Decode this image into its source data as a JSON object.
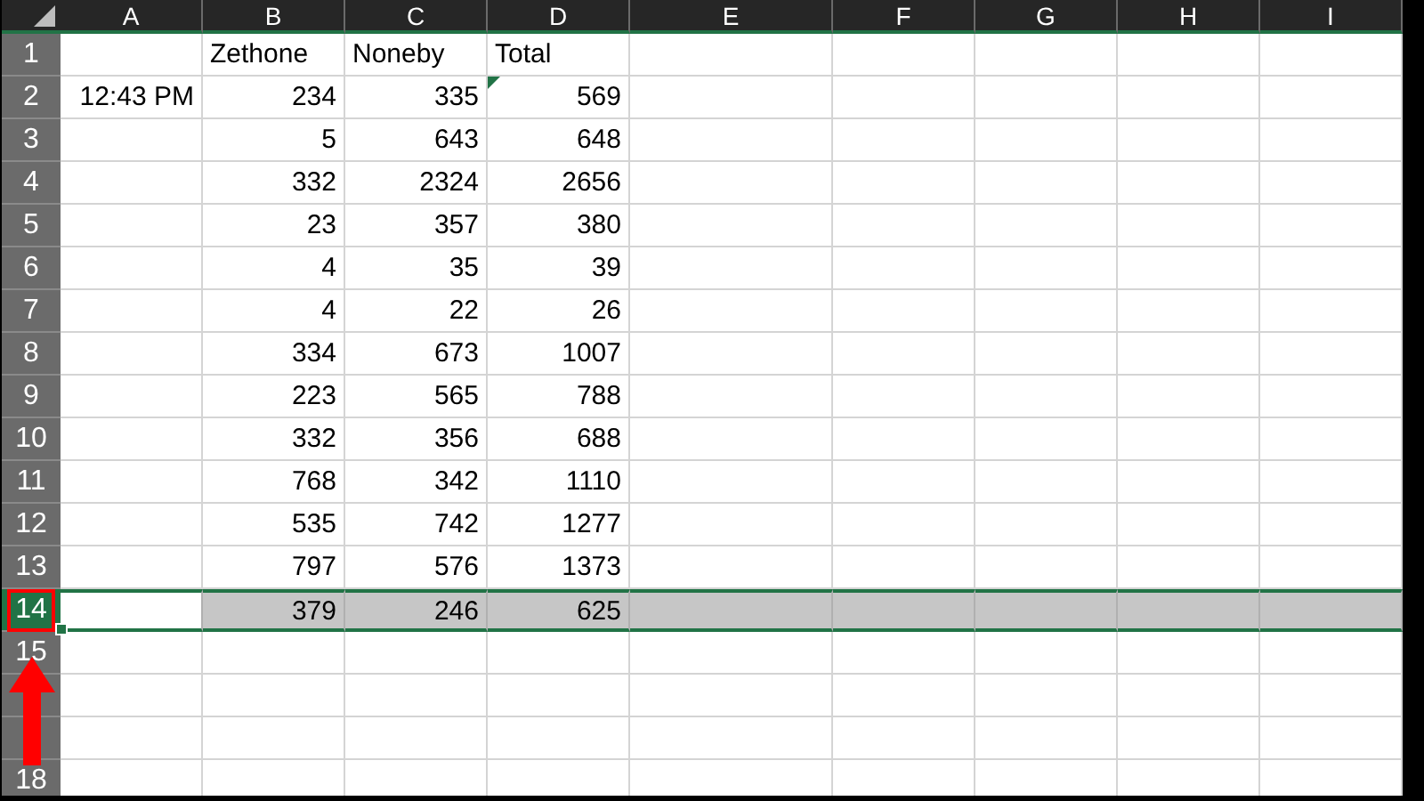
{
  "columns": [
    "A",
    "B",
    "C",
    "D",
    "E",
    "F",
    "G",
    "H",
    "I"
  ],
  "rows": [
    {
      "header": "1",
      "kind": "labels",
      "selected": false,
      "error_marker": false,
      "col_b": "Zethone",
      "col_c": "Noneby",
      "col_d": "Total"
    },
    {
      "header": "2",
      "kind": "values",
      "selected": false,
      "error_marker": true,
      "col_a": "12:43 PM",
      "col_b": "234",
      "col_c": "335",
      "col_d": "569"
    },
    {
      "header": "3",
      "kind": "values",
      "selected": false,
      "error_marker": false,
      "col_b": "5",
      "col_c": "643",
      "col_d": "648"
    },
    {
      "header": "4",
      "kind": "values",
      "selected": false,
      "error_marker": false,
      "col_b": "332",
      "col_c": "2324",
      "col_d": "2656"
    },
    {
      "header": "5",
      "kind": "values",
      "selected": false,
      "error_marker": false,
      "col_b": "23",
      "col_c": "357",
      "col_d": "380"
    },
    {
      "header": "6",
      "kind": "values",
      "selected": false,
      "error_marker": false,
      "col_b": "4",
      "col_c": "35",
      "col_d": "39"
    },
    {
      "header": "7",
      "kind": "values",
      "selected": false,
      "error_marker": false,
      "col_b": "4",
      "col_c": "22",
      "col_d": "26"
    },
    {
      "header": "8",
      "kind": "values",
      "selected": false,
      "error_marker": false,
      "col_b": "334",
      "col_c": "673",
      "col_d": "1007"
    },
    {
      "header": "9",
      "kind": "values",
      "selected": false,
      "error_marker": false,
      "col_b": "223",
      "col_c": "565",
      "col_d": "788"
    },
    {
      "header": "10",
      "kind": "values",
      "selected": false,
      "error_marker": false,
      "col_b": "332",
      "col_c": "356",
      "col_d": "688"
    },
    {
      "header": "11",
      "kind": "values",
      "selected": false,
      "error_marker": false,
      "col_b": "768",
      "col_c": "342",
      "col_d": "1110"
    },
    {
      "header": "12",
      "kind": "values",
      "selected": false,
      "error_marker": false,
      "col_b": "535",
      "col_c": "742",
      "col_d": "1277"
    },
    {
      "header": "13",
      "kind": "values",
      "selected": false,
      "error_marker": false,
      "col_b": "797",
      "col_c": "576",
      "col_d": "1373"
    },
    {
      "header": "14",
      "kind": "values",
      "selected": true,
      "error_marker": false,
      "col_b": "379",
      "col_c": "246",
      "col_d": "625"
    },
    {
      "header": "15",
      "kind": "values",
      "selected": false,
      "error_marker": false
    },
    {
      "kind": "values",
      "selected": false,
      "error_marker": false
    },
    {
      "kind": "values",
      "selected": false,
      "error_marker": false
    },
    {
      "header": "18",
      "kind": "values",
      "selected": false,
      "error_marker": false
    }
  ]
}
